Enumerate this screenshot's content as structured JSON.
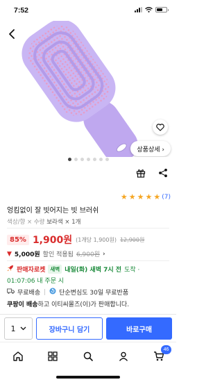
{
  "status_bar": {
    "time": "7:52"
  },
  "product": {
    "title": "엉킴없이 잘 빗어지는 빗 브러쉬",
    "rating_count": "(7)",
    "option_label": "색상/향 × 수량",
    "option_value": "보라색 × 1개",
    "discount": "85%",
    "price": "1,900원",
    "unit_price": "(1개당 1,900원)",
    "original_price": "12,900원"
  },
  "image": {
    "detail_button": "상품상세 ›",
    "dots_total": 7,
    "dots_active": 0
  },
  "coupon": {
    "amount": "5,000원",
    "applied_text": "할인 적용됨",
    "strike_price": "6,900원",
    "chevron": "›"
  },
  "delivery": {
    "rocket_label": "판매자로켓",
    "dawn_badge": "새벽",
    "arrival": "내일(화) 새벽 7시 전",
    "arrival_tail": "도착 ·",
    "countdown": "01:07:06 내 주문 시"
  },
  "shipping": {
    "free_shipping": "무료배송",
    "return_policy": "단순변심도 30일 무료반품"
  },
  "seller": {
    "name": "쿠팡이 배송",
    "tail": "하고 이티씨몰즈(이)가 판매합니다."
  },
  "buy_bar": {
    "quantity": "1",
    "cart_button": "장바구니 담기",
    "buy_button": "바로구매"
  },
  "nav": {
    "cart_badge": "46"
  },
  "colors": {
    "accent": "#346aff",
    "sale_red": "#d92c2c",
    "dawn_green": "#1a8a3a",
    "star": "#f5a623"
  },
  "icons": [
    "back-arrow-icon",
    "heart-icon",
    "gift-icon",
    "share-icon",
    "star-icon",
    "down-arrow-icon",
    "rocket-icon",
    "truck-icon",
    "return-icon",
    "chevron-down-icon",
    "home-icon",
    "category-icon",
    "search-icon",
    "user-icon",
    "cart-icon"
  ]
}
